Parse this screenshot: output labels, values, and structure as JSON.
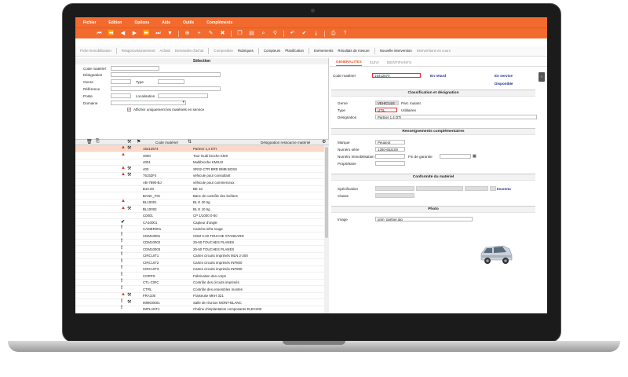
{
  "menu": [
    "Fichier",
    "Edition",
    "Options",
    "Aide",
    "Outils",
    "Compléments"
  ],
  "toolbar_icons": [
    "first-icon",
    "prev-page-icon",
    "prev-icon",
    "next-icon",
    "next-page-icon",
    "last-icon",
    "filter-icon",
    "add-row-icon",
    "plus-icon",
    "edit-icon",
    "delete-icon",
    "copy-icon",
    "paste-icon",
    "search-icon",
    "search-advanced-icon",
    "undo-icon",
    "check-icon",
    "save-icon",
    "print-icon",
    "help-icon"
  ],
  "navbar": [
    "Fiche immobilisation",
    "Réapprovisionnement",
    "Achats",
    "Demandes d'achat",
    "Composition",
    "Rubriques",
    "Compteurs",
    "Planification",
    "Evènements",
    "Résultats de mesure",
    "Nouvelle intervention",
    "Interventions en cours"
  ],
  "selection": {
    "title": "Sélection",
    "labels": {
      "code": "Code matériel",
      "designation": "Désignation",
      "genre": "Genre",
      "type": "Type",
      "reference": "Référence",
      "poste": "Poste",
      "localisation": "Localisation",
      "domaine": "Domaine"
    },
    "checkbox_label": "Afficher uniquement les matériels en service"
  },
  "grid": {
    "headers": {
      "code": "Code matériel",
      "designation": "Désignation ressource matériel"
    },
    "rows": [
      {
        "status": "▲",
        "tool": "⚒",
        "code": "15412574",
        "designation": "Partner 1,4 DTI"
      },
      {
        "status": "▲",
        "tool": "",
        "code": "4000",
        "designation": "Tour multi broche KMX"
      },
      {
        "status": "",
        "tool": "",
        "code": "4001",
        "designation": "Multibroche KMX42"
      },
      {
        "status": "▲",
        "tool": "⚒",
        "code": "403",
        "designation": "SR32-CTR BRD BMB BOSS"
      },
      {
        "status": "▲",
        "tool": "⚒",
        "code": "76152F4",
        "designation": "véhicule pour consultant"
      },
      {
        "status": "",
        "tool": "",
        "code": "AB-7890-BJ",
        "designation": "véhicule pour commerceux"
      },
      {
        "status": "",
        "tool": "",
        "code": "B10.00",
        "designation": "BE    10"
      },
      {
        "status": "",
        "tool": "",
        "code": "BANC_FIN",
        "designation": "Banc de contrôle des boîtiers"
      },
      {
        "status": "▲",
        "tool": "",
        "code": "BL10001",
        "designation": "BL E    20 6g"
      },
      {
        "status": "▲",
        "tool": "⚒",
        "code": "BL10002",
        "designation": "BL E    10 6g"
      },
      {
        "status": "",
        "tool": "",
        "code": "C0001",
        "designation": "CP 1/1000 0-50"
      },
      {
        "status": "✔",
        "tool": "",
        "code": "CA10001",
        "designation": "Capteur d'angle"
      },
      {
        "status": "!",
        "tool": "",
        "code": "CAMER001",
        "designation": "Caméra infra rouge"
      },
      {
        "status": "!",
        "tool": "",
        "code": "CDM10001",
        "designation": "CDM 0-40 TOUCHE STANDARD"
      },
      {
        "status": "!",
        "tool": "",
        "code": "CDM10002",
        "designation": "25-50 TOUCHES PLANES"
      },
      {
        "status": "!",
        "tool": "",
        "code": "CDM10003",
        "designation": "25-50 TOUCHES PLANES"
      },
      {
        "status": "!",
        "tool": "",
        "code": "CIRCUIT1",
        "designation": "Cartes circuits imprimés MLN 2-200"
      },
      {
        "status": "!",
        "tool": "",
        "code": "CIRCUIT2",
        "designation": "Cartes circuits imprimés INF800"
      },
      {
        "status": "!",
        "tool": "",
        "code": "CIRCUIT3",
        "designation": "Cartes circuits imprimés INF800"
      },
      {
        "status": "!",
        "tool": "",
        "code": "CORPS",
        "designation": "Fabrication des corps"
      },
      {
        "status": "!",
        "tool": "",
        "code": "CTL-CIRC",
        "designation": "Contrôle des circuits imprimés"
      },
      {
        "status": "!",
        "tool": "",
        "code": "CTRL",
        "designation": "Contrôle des ensembles montés"
      },
      {
        "status": "▲",
        "tool": "⚒",
        "code": "FRA100",
        "designation": "Fraiseuse MKH 321"
      },
      {
        "status": "!",
        "tool": "⚒",
        "code": "IMMO0001",
        "designation": "Salle de réunion MONT-BLANC"
      },
      {
        "status": "!",
        "tool": "",
        "code": "IMPLANT1",
        "designation": "Chaîne d'implantation composants ELEC200"
      }
    ]
  },
  "detail": {
    "tabs": [
      "GENERALITES",
      "SUIVI",
      "IDENTIFIANTS"
    ],
    "code_label": "Code matériel",
    "code_value": "15412574",
    "status_late": "En retard",
    "status_service": "En service",
    "status_available": "Disponible",
    "classification": {
      "title": "Classification et désignation",
      "genre_label": "Genre",
      "genre_code": "VEHICULE",
      "genre_desc": "Parc roulant",
      "type_label": "Type",
      "type_code": "UTIL",
      "type_desc": "Utilitaires",
      "designation_label": "Désignation",
      "designation_value": "Partner 1,4 DTI"
    },
    "complementary": {
      "title": "Renseignements complémentaires",
      "marque_label": "Marque",
      "marque_value": "Peugeot",
      "serie_label": "Numéro série",
      "serie_value": "1250-652100",
      "immo_label": "Numéro immobilisation",
      "garantie_label": "Fin de garantie",
      "proprio_label": "Propriétaire"
    },
    "conformity": {
      "title": "Conformité du matériel",
      "spec_label": "Spécification",
      "spec_status": "Inconnu",
      "classe_label": "Classe"
    },
    "photo": {
      "title": "Photo",
      "image_label": "Image",
      "image_value": "gnm_partner.jpg"
    }
  },
  "colors": {
    "accent": "#f26a2e",
    "selected_row": "#fbd9c9",
    "status_blue": "#1e2f8f",
    "required_border": "#e03030"
  }
}
